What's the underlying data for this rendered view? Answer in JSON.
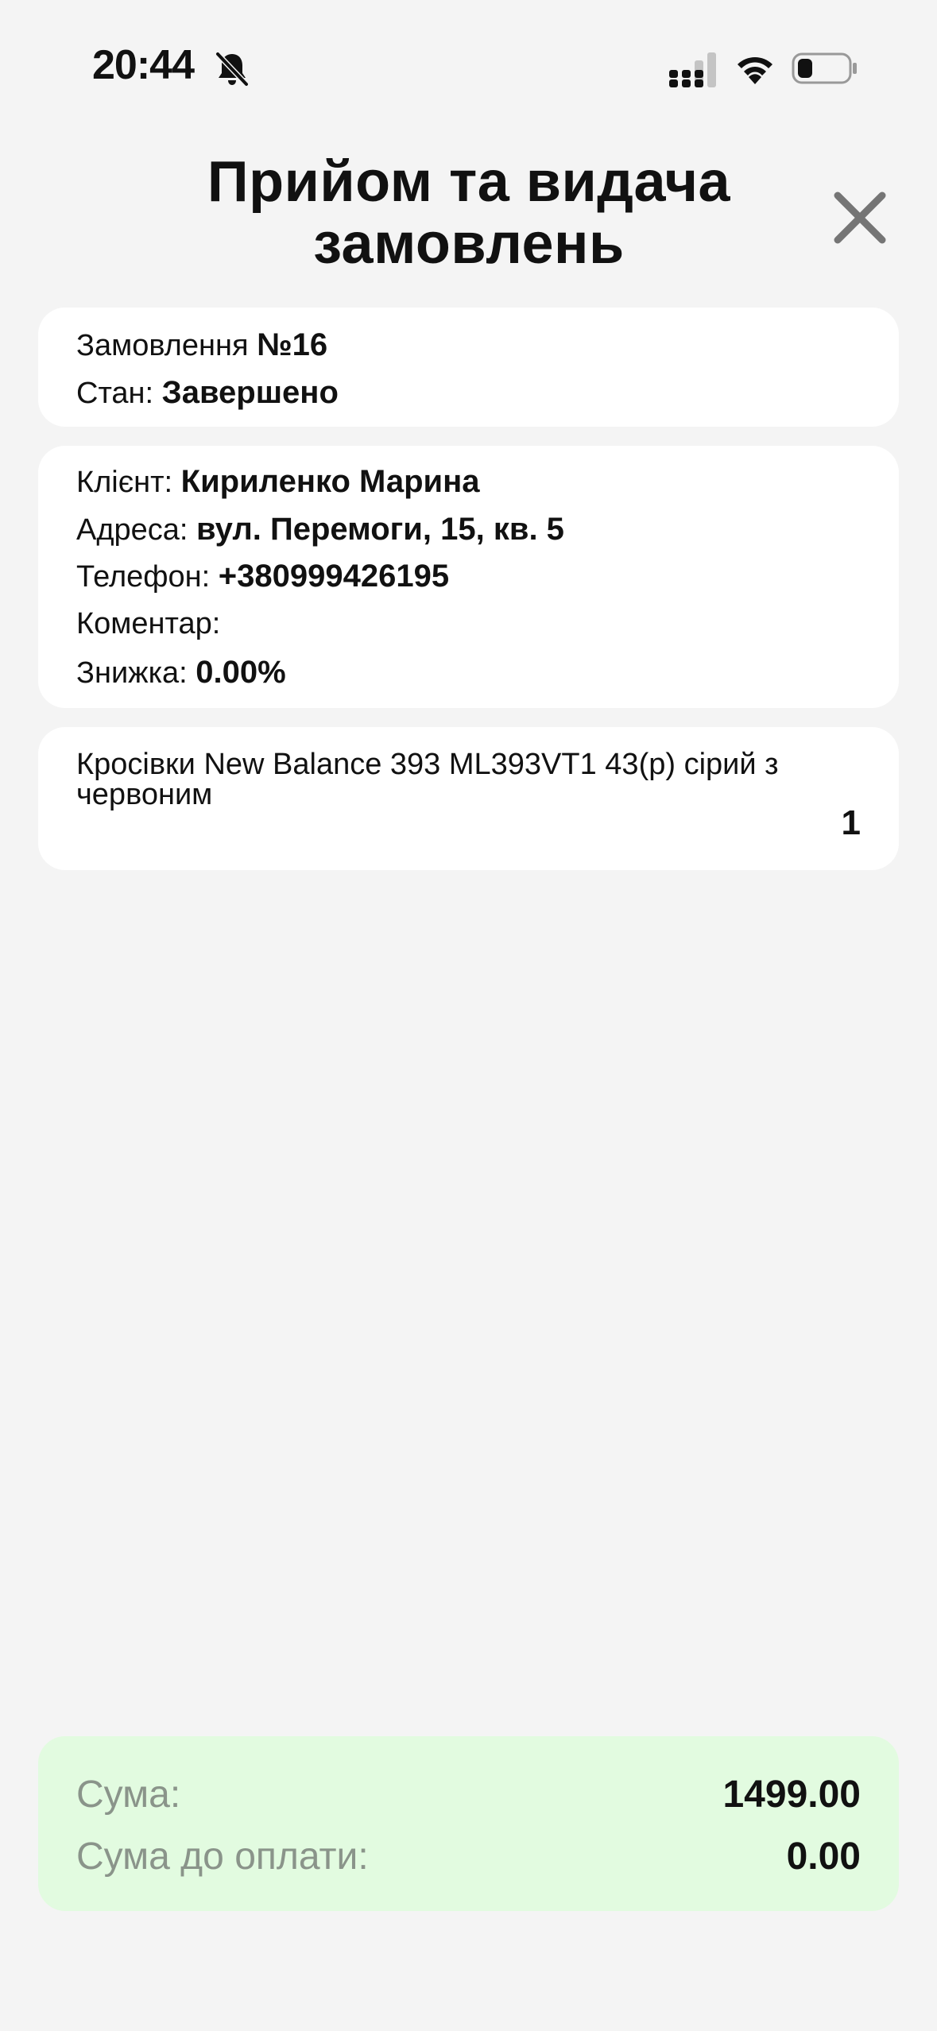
{
  "status_bar": {
    "time": "20:44",
    "icons": [
      "bell-muted-icon",
      "signal-icon",
      "wifi-icon",
      "battery-icon"
    ]
  },
  "header": {
    "title_line1": "Прийом та видача",
    "title_line2": "замовлень",
    "close_icon": "close-icon"
  },
  "order": {
    "number_label": "Замовлення ",
    "number_value": "№16",
    "state_label": "Стан: ",
    "state_value": "Завершено"
  },
  "client": {
    "name_label": "Клієнт: ",
    "name_value": "Кириленко Марина",
    "address_label": "Адреса: ",
    "address_value": "вул. Перемоги, 15, кв. 5",
    "phone_label": "Телефон: ",
    "phone_value": "+380999426195",
    "comment_label": "Коментар:",
    "discount_label": "Знижка: ",
    "discount_value": "0.00%"
  },
  "items": [
    {
      "name": "Кросівки New Balance 393 ML393VT1 43(р) сірий з червоним",
      "quantity": "1"
    }
  ],
  "summary": {
    "sum_label": "Сума:",
    "sum_value": "1499.00",
    "to_pay_label": "Сума до оплати:",
    "to_pay_value": "0.00"
  },
  "colors": {
    "background": "#f4f4f4",
    "card": "#ffffff",
    "summary_bg": "#e2fbe0",
    "summary_label": "#8a948a",
    "close_icon": "#757575"
  }
}
